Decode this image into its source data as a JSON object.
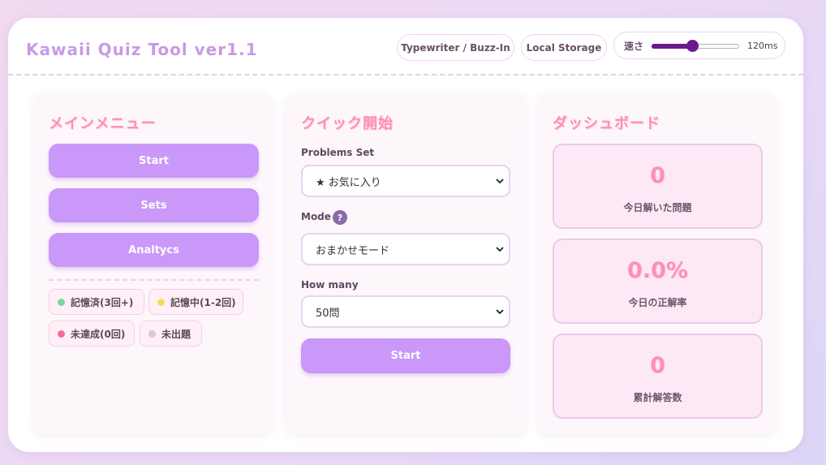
{
  "app": {
    "title": "Kawaii Quiz Tool ver1.1"
  },
  "header": {
    "mode_pill": "Typewriter / Buzz-In",
    "storage_pill": "Local Storage",
    "speed": {
      "label": "速さ",
      "value_text": "120ms",
      "fraction": 0.46,
      "color": "#6a1a8c"
    }
  },
  "main_menu": {
    "title": "メインメニュー",
    "buttons": [
      "Start",
      "Sets",
      "Analtycs"
    ],
    "legend": [
      {
        "label": "記憶済(3回+)",
        "color": "#7ed89a"
      },
      {
        "label": "記憶中(1-2回)",
        "color": "#f3de5a"
      },
      {
        "label": "未達成(0回)",
        "color": "#f56b93"
      },
      {
        "label": "未出題",
        "color": "#d6c9dc"
      }
    ]
  },
  "quick_start": {
    "title": "クイック開始",
    "problems_set": {
      "label": "Problems Set",
      "value": "★ お気に入り"
    },
    "mode": {
      "label": "Mode",
      "help_icon": "?",
      "value": "おまかせモード"
    },
    "how_many": {
      "label": "How many",
      "value": "50問"
    },
    "start_button": "Start"
  },
  "dashboard": {
    "title": "ダッシュボード",
    "stats": [
      {
        "value": "0",
        "label": "今日解いた問題"
      },
      {
        "value": "0.0%",
        "label": "今日の正解率"
      },
      {
        "value": "0",
        "label": "累計解答数"
      }
    ]
  },
  "colors": {
    "accent": "#c998f9",
    "title_pink": "#ff8fb5",
    "app_title": "#c79ae6"
  }
}
